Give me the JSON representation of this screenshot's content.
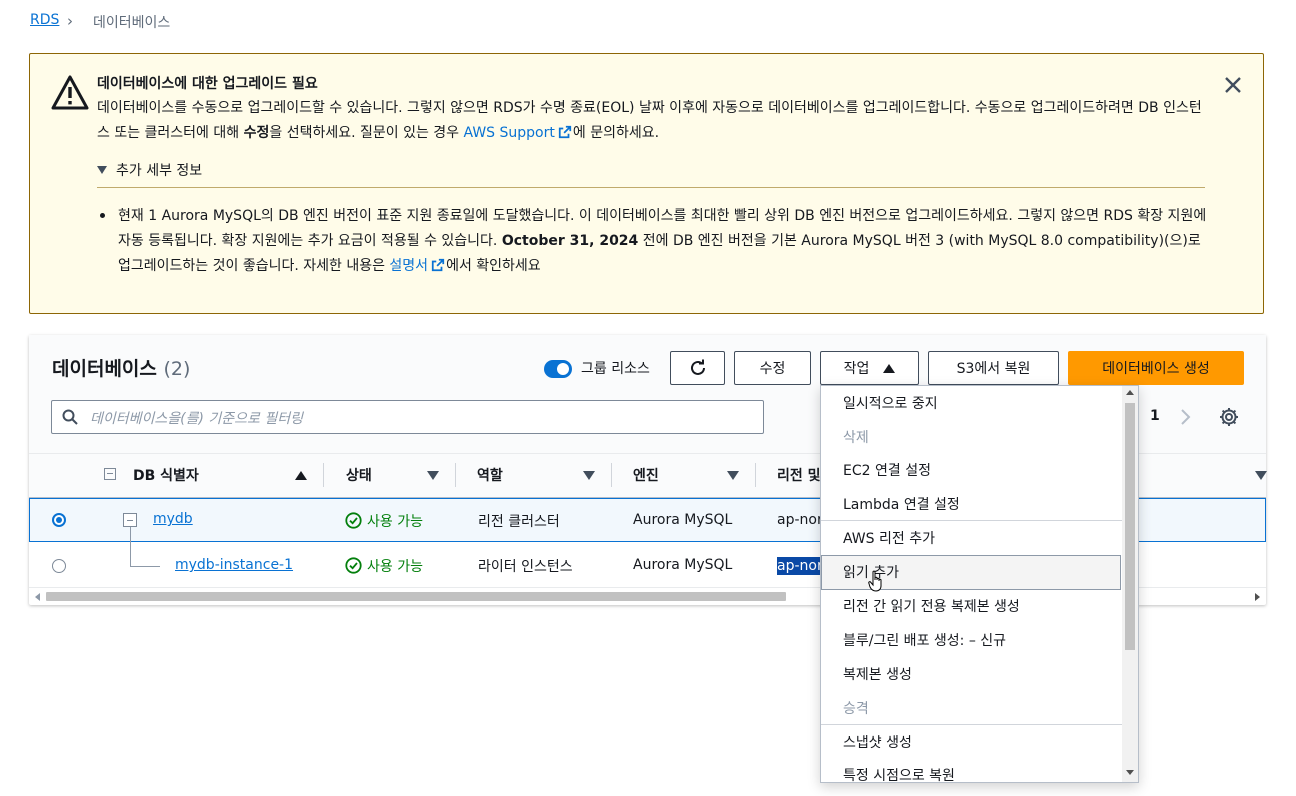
{
  "breadcrumb": {
    "root": "RDS",
    "separator": "›",
    "current": "데이터베이스"
  },
  "banner": {
    "title": "데이터베이스에 대한 업그레이드 필요",
    "text_part1": "데이터베이스를 수동으로 업그레이드할 수 있습니다. 그렇지 않으면 RDS가 수명 종료(EOL) 날짜 이후에 자동으로 데이터베이스를 업그레이드합니다. 수동으로 업그레이드하려면 DB 인스턴스 또는 클러스터에 대해 ",
    "text_bold": "수정",
    "text_part2": "을 선택하세요. 질문이 있는 경우 ",
    "support_link": "AWS Support",
    "text_part3": "에 문의하세요.",
    "details_label": "추가 세부 정보",
    "details_part1": "현재 1 Aurora MySQL의 DB 엔진 버전이 표준 지원 종료일에 도달했습니다. 이 데이터베이스를 최대한 빨리 상위 DB 엔진 버전으로 업그레이드하세요. 그렇지 않으면 RDS 확장 지원에 자동 등록됩니다. 확장 지원에는 추가 요금이 적용될 수 있습니다. ",
    "details_date": "October 31, 2024",
    "details_part2": " 전에 DB 엔진 버전을 기본 Aurora MySQL 버전 3 (with MySQL 8.0 compatibility)(으)로 업그레이드하는 것이 좋습니다. 자세한 내용은 ",
    "docs_link": "설명서",
    "details_part3": "에서 확인하세요"
  },
  "panel": {
    "title": "데이터베이스",
    "count": "(2)",
    "group_toggle_label": "그룹 리소스",
    "modify_label": "수정",
    "actions_label": "작업",
    "restore_s3_label": "S3에서 복원",
    "create_label": "데이터베이스 생성",
    "search_placeholder": "데이터베이스을(를) 기준으로 필터링",
    "page_number": "1"
  },
  "table": {
    "columns": [
      "DB 식별자",
      "상태",
      "역할",
      "엔진",
      "리전 및"
    ],
    "rows": [
      {
        "id": "mydb",
        "status": "사용 가능",
        "role": "리전 클러스터",
        "engine": "Aurora MySQL",
        "region": "ap-nor"
      },
      {
        "id": "mydb-instance-1",
        "status": "사용 가능",
        "role": "라이터 인스턴스",
        "engine": "Aurora MySQL",
        "region": "ap-nor"
      }
    ]
  },
  "actions_menu": {
    "items": [
      {
        "label": "일시적으로 중지",
        "disabled": false
      },
      {
        "label": "삭제",
        "disabled": true
      },
      {
        "label": "EC2 연결 설정",
        "disabled": false
      },
      {
        "label": "Lambda 연결 설정",
        "disabled": false
      },
      {
        "label": "AWS 리전 추가",
        "disabled": false
      },
      {
        "label": "읽기 추가",
        "disabled": false
      },
      {
        "label": "리전 간 읽기 전용 복제본 생성",
        "disabled": false
      },
      {
        "label": "블루/그린 배포 생성: – 신규",
        "disabled": false
      },
      {
        "label": "복제본 생성",
        "disabled": false
      },
      {
        "label": "승격",
        "disabled": true
      },
      {
        "label": "스냅샷 생성",
        "disabled": false
      },
      {
        "label": "특정 시점으로 복원",
        "disabled": false
      }
    ]
  },
  "colors": {
    "accent": "#0972d3",
    "primary_button": "#ff9900",
    "warning_bg": "#fffce9",
    "success": "#037f0c"
  }
}
